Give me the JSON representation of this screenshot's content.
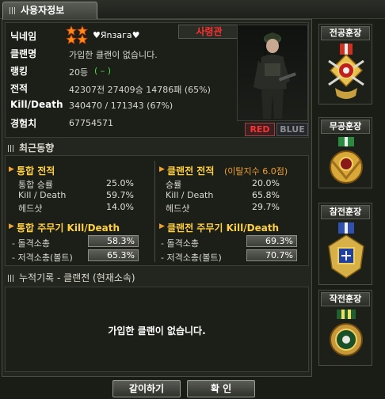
{
  "tab": {
    "title": "사용자정보"
  },
  "profile": {
    "nickname_label": "닉네임",
    "nickname": "♥Яnзaгa♥",
    "rank_title": "사령관",
    "clan_label": "클랜명",
    "clan_value": "가입한 클랜이 없습니다.",
    "ranking_label": "랭킹",
    "ranking_value": "20등",
    "ranking_change": "( – )",
    "record_label": "전적",
    "record_value": "42307전 27409승 14786패 (65%)",
    "kd_label": "Kill/Death",
    "kd_value": "340470 / 171343 (67%)",
    "exp_label": "경험치",
    "exp_value": "67754571",
    "team_red": "RED",
    "team_blue": "BLUE"
  },
  "recent": {
    "title": "최근동향",
    "total_title": "통합 전적",
    "total_rows": [
      {
        "label": "통합 승률",
        "value": "25.0%"
      },
      {
        "label": "Kill / Death",
        "value": "59.7%"
      },
      {
        "label": "헤드샷",
        "value": "14.0%"
      }
    ],
    "clan_title": "클랜전 전적",
    "clan_note": "(이탈지수 6.0점)",
    "clan_rows": [
      {
        "label": "승률",
        "value": "20.0%"
      },
      {
        "label": "Kill / Death",
        "value": "65.8%"
      },
      {
        "label": "헤드샷",
        "value": "29.7%"
      }
    ],
    "total_weapon_title": "통합 주무기 Kill/Death",
    "total_weapons": [
      {
        "label": "- 돌격소총",
        "value": "58.3%"
      },
      {
        "label": "- 저격소총(볼트)",
        "value": "65.3%"
      }
    ],
    "clan_weapon_title": "클랜전 주무기 Kill/Death",
    "clan_weapons": [
      {
        "label": "- 돌격소총",
        "value": "69.3%"
      },
      {
        "label": "- 저격소총(볼트)",
        "value": "70.7%"
      }
    ]
  },
  "cumulative": {
    "title": "누적기록 - 클랜전 (현재소속)",
    "message": "가입한 클랜이 없습니다."
  },
  "medals": [
    {
      "label": "전공훈장",
      "icon": "combat-merit-medal-icon"
    },
    {
      "label": "무공훈장",
      "icon": "military-merit-medal-icon"
    },
    {
      "label": "참전훈장",
      "icon": "participation-medal-icon"
    },
    {
      "label": "작전훈장",
      "icon": "operation-medal-icon"
    }
  ],
  "buttons": {
    "together": "같이하기",
    "confirm": "확 인"
  },
  "colors": {
    "accent_orange": "#f0a030",
    "team_red": "#ff3030",
    "heading_yellow": "#ffd040"
  }
}
